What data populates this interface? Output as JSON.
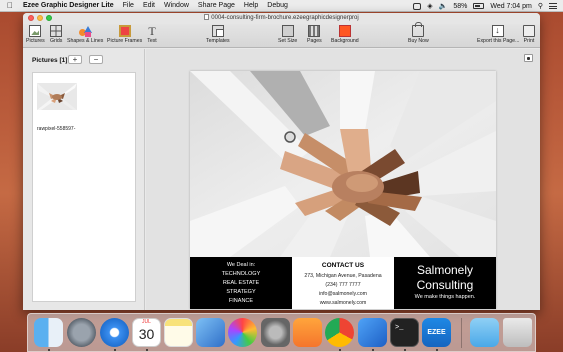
{
  "menubar": {
    "app_name": "Ezee Graphic Designer Lite",
    "items": [
      "File",
      "Edit",
      "Window",
      "Share Page",
      "Help",
      "Debug"
    ],
    "battery": "58%",
    "clock": "Wed 7:04 pm"
  },
  "window": {
    "title": "0004-consulting-firm-brochure.ezeegraphicdesignerproj"
  },
  "toolbar": {
    "pictures": "Pictures",
    "grids": "Grids",
    "shapes": "Shapes & Lines",
    "frames": "Picture Frames",
    "text": "Text",
    "templates": "Templates",
    "set_size": "Set Size",
    "pages": "Pages",
    "background": "Background",
    "buy_now": "Buy Now",
    "export": "Export this Page...",
    "print": "Print"
  },
  "sidebar": {
    "heading": "Pictures [1]",
    "add": "+",
    "remove": "−",
    "items": [
      {
        "label": "rawpixel-558597-"
      }
    ]
  },
  "brochure": {
    "col1": {
      "heading": "We Deal in:",
      "lines": [
        "TECHNOLOGY",
        "REAL ESTATE",
        "STRATEGY",
        "FINANCE"
      ]
    },
    "col2": {
      "heading": "CONTACT US",
      "lines": [
        "273, Michigan Avenue, Pasadena",
        "(234) 777 7777",
        "info@salmonely.com",
        "www.salmonely.com"
      ]
    },
    "col3": {
      "line1": "Salmonely",
      "line2": "Consulting",
      "tagline": "We make things happen."
    }
  },
  "dock": {
    "apps": [
      "finder-icon",
      "launchpad-icon",
      "safari-icon",
      "calendar-icon",
      "notes-icon",
      "preview-icon",
      "photos-icon",
      "system-preferences-icon",
      "books-icon",
      "chrome-icon",
      "xcode-icon",
      "terminal-icon",
      "ezee-icon",
      "downloads-folder-icon",
      "trash-icon"
    ],
    "calendar_month": "JUL",
    "calendar_day": "30",
    "ezee_label": "EZEE"
  },
  "colors": {
    "accent_orange": "#ff5722",
    "brochure_black": "#000000"
  }
}
